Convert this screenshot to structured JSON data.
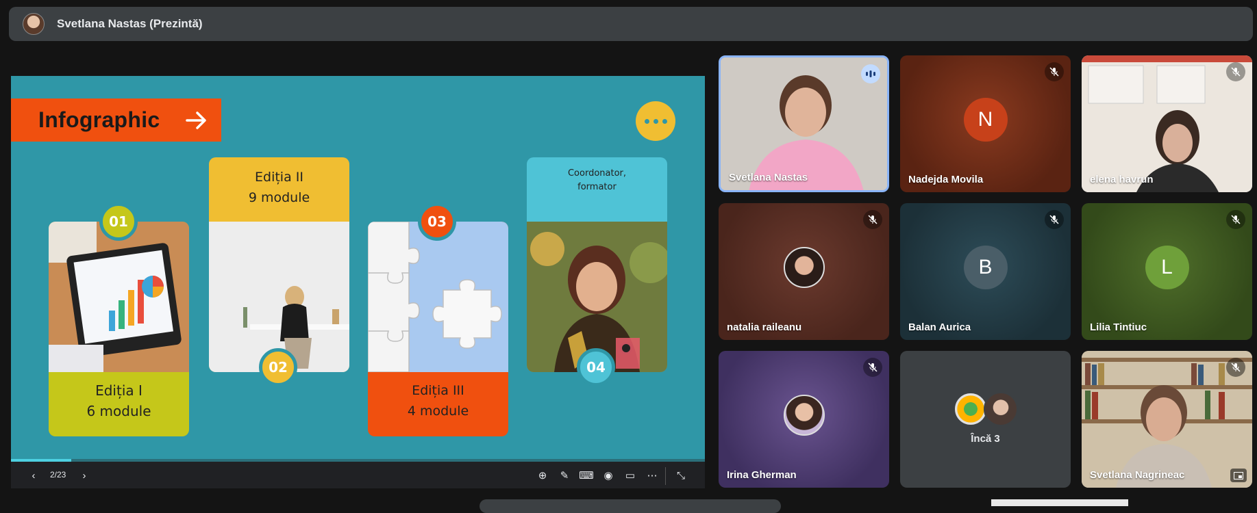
{
  "header": {
    "presenter_title": "Svetlana Nastas (Prezintă)"
  },
  "slide": {
    "banner_title": "Infographic",
    "cards": [
      {
        "badge": "01",
        "line1": "Ediția I",
        "line2": "6 module",
        "color": "#c5c71a"
      },
      {
        "badge": "02",
        "line1": "Ediția II",
        "line2": "9 module",
        "color": "#f0be32"
      },
      {
        "badge": "03",
        "line1": "Ediția III",
        "line2": "4 module",
        "color": "#f0500f"
      },
      {
        "badge": "04",
        "line1": "Coordonator,",
        "line2": "formator",
        "color": "#4fc3d6"
      }
    ]
  },
  "controls": {
    "page": "2/23"
  },
  "participants": [
    {
      "name": "Svetlana Nastas",
      "speaking": true
    },
    {
      "name": "Nadejda Movila",
      "initial": "N",
      "muted": true
    },
    {
      "name": "elena havrun",
      "muted": true
    },
    {
      "name": "natalia raileanu",
      "muted": true
    },
    {
      "name": "Balan Aurica",
      "initial": "B",
      "muted": true
    },
    {
      "name": "Lilia Tintiuc",
      "initial": "L",
      "muted": true
    },
    {
      "name": "Irina Gherman",
      "muted": true
    },
    {
      "name": "",
      "more_label": "Încă 3"
    },
    {
      "name": "Svetlana Nagrineac",
      "muted": true
    }
  ],
  "colors": {
    "accent_speaking": "#8ab4f8",
    "slide_bg": "#2f97a7",
    "banner": "#f0500f"
  }
}
